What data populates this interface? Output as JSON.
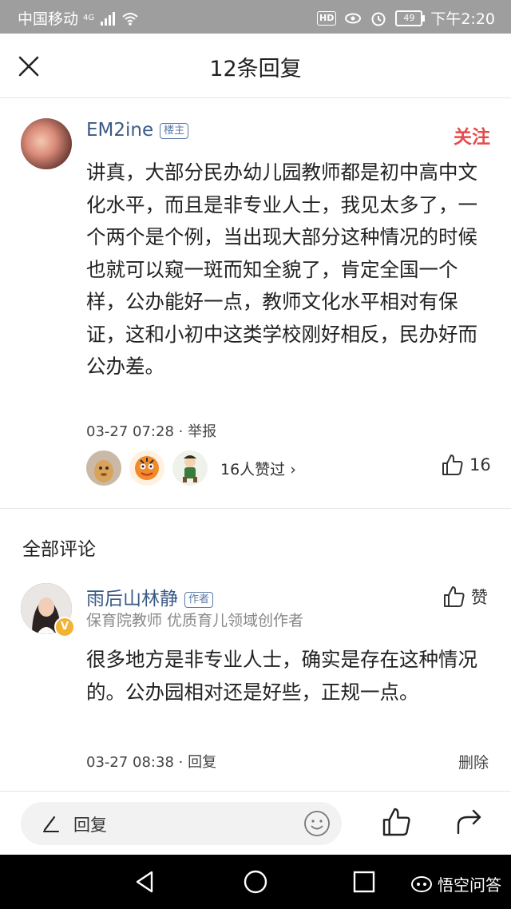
{
  "status_bar": {
    "carrier": "中国移动",
    "network": "4G",
    "hd": "HD",
    "battery": "49",
    "time": "下午2:20"
  },
  "header": {
    "title": "12条回复"
  },
  "original_post": {
    "username": "EM2ine",
    "badge": "楼主",
    "follow_label": "关注",
    "body": "讲真，大部分民办幼儿园教师都是初中高中文化水平，而且是非专业人士，我见太多了，一个两个是个例，当出现大部分这种情况的时候也就可以窥一斑而知全貌了，肯定全国一个样，公办能好一点，教师文化水平相对有保证，这和小初中这类学校刚好相反，民办好而公办差。",
    "timestamp": "03-27 07:28",
    "report_label": "举报",
    "likers_text": "16人赞过",
    "like_count": "16"
  },
  "comments_section": {
    "title": "全部评论"
  },
  "comment": {
    "username": "雨后山林静",
    "badge": "作者",
    "verified_mark": "V",
    "subtitle": "保育院教师 优质育儿领域创作者",
    "like_label": "赞",
    "body": "很多地方是非专业人士，确实是存在这种情况的。公办园相对还是好些，正规一点。",
    "timestamp": "03-27 08:38",
    "reply_label": "回复",
    "delete_label": "删除"
  },
  "bottom_bar": {
    "reply_placeholder": "回复"
  },
  "watermark": {
    "text": "悟空问答"
  },
  "colors": {
    "follow": "#e84a4a",
    "username": "#3a5a86",
    "status_bar": "#9e9e9e"
  }
}
